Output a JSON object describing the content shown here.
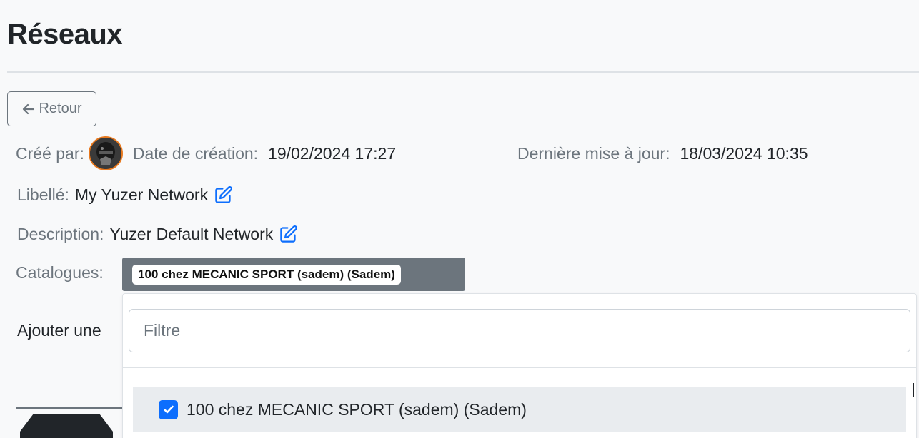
{
  "page": {
    "title": "Réseaux"
  },
  "actions": {
    "back_label": "Retour"
  },
  "details": {
    "created_by_label": "Créé par:",
    "creation_date_label": "Date de création:",
    "creation_date_value": "19/02/2024 17:27",
    "last_update_label": "Dernière mise à jour:",
    "last_update_value": "18/03/2024 10:35",
    "label_label": "Libellé:",
    "label_value": "My Yuzer Network",
    "description_label": "Description:",
    "description_value": "Yuzer Default Network",
    "catalogs_label": "Catalogues:",
    "selected_catalog": "100 chez MECANIC SPORT (sadem) (Sadem)",
    "add_label_partial": "Ajouter une"
  },
  "dropdown": {
    "filter_placeholder": "Filtre",
    "options": [
      {
        "label": "100 chez MECANIC SPORT (sadem) (Sadem)",
        "checked": true
      }
    ]
  },
  "colors": {
    "accent": "#0d6efd",
    "muted": "#6c757d",
    "avatar_border": "#e8791e"
  },
  "icons": {
    "back": "arrow-left-icon",
    "edit": "edit-icon",
    "checkbox": "check-icon"
  }
}
